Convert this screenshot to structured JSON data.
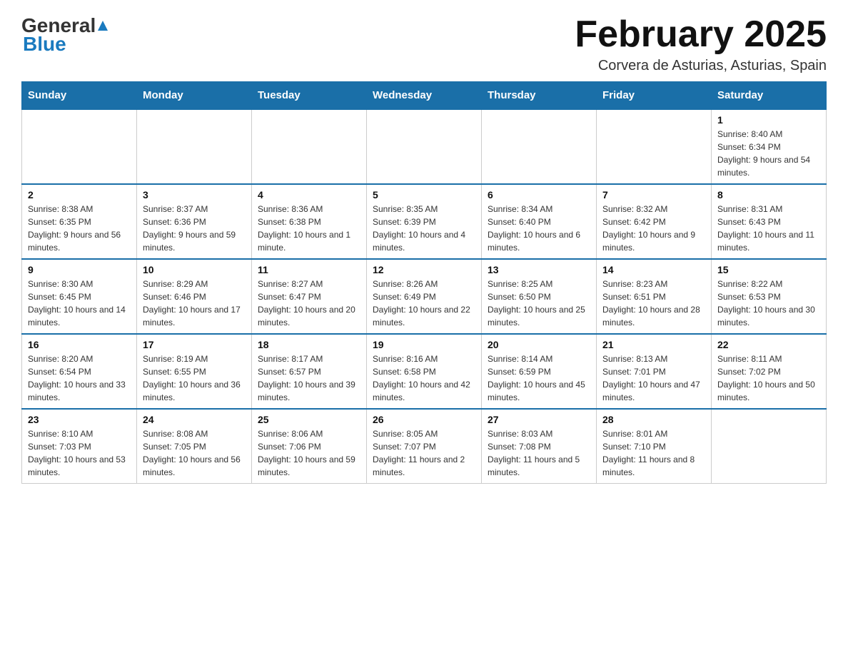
{
  "header": {
    "logo": {
      "general": "General",
      "blue": "Blue",
      "tagline": "Blue"
    },
    "title": "February 2025",
    "location": "Corvera de Asturias, Asturias, Spain"
  },
  "calendar": {
    "days_of_week": [
      "Sunday",
      "Monday",
      "Tuesday",
      "Wednesday",
      "Thursday",
      "Friday",
      "Saturday"
    ],
    "weeks": [
      [
        {
          "day": "",
          "info": ""
        },
        {
          "day": "",
          "info": ""
        },
        {
          "day": "",
          "info": ""
        },
        {
          "day": "",
          "info": ""
        },
        {
          "day": "",
          "info": ""
        },
        {
          "day": "",
          "info": ""
        },
        {
          "day": "1",
          "info": "Sunrise: 8:40 AM\nSunset: 6:34 PM\nDaylight: 9 hours and 54 minutes."
        }
      ],
      [
        {
          "day": "2",
          "info": "Sunrise: 8:38 AM\nSunset: 6:35 PM\nDaylight: 9 hours and 56 minutes."
        },
        {
          "day": "3",
          "info": "Sunrise: 8:37 AM\nSunset: 6:36 PM\nDaylight: 9 hours and 59 minutes."
        },
        {
          "day": "4",
          "info": "Sunrise: 8:36 AM\nSunset: 6:38 PM\nDaylight: 10 hours and 1 minute."
        },
        {
          "day": "5",
          "info": "Sunrise: 8:35 AM\nSunset: 6:39 PM\nDaylight: 10 hours and 4 minutes."
        },
        {
          "day": "6",
          "info": "Sunrise: 8:34 AM\nSunset: 6:40 PM\nDaylight: 10 hours and 6 minutes."
        },
        {
          "day": "7",
          "info": "Sunrise: 8:32 AM\nSunset: 6:42 PM\nDaylight: 10 hours and 9 minutes."
        },
        {
          "day": "8",
          "info": "Sunrise: 8:31 AM\nSunset: 6:43 PM\nDaylight: 10 hours and 11 minutes."
        }
      ],
      [
        {
          "day": "9",
          "info": "Sunrise: 8:30 AM\nSunset: 6:45 PM\nDaylight: 10 hours and 14 minutes."
        },
        {
          "day": "10",
          "info": "Sunrise: 8:29 AM\nSunset: 6:46 PM\nDaylight: 10 hours and 17 minutes."
        },
        {
          "day": "11",
          "info": "Sunrise: 8:27 AM\nSunset: 6:47 PM\nDaylight: 10 hours and 20 minutes."
        },
        {
          "day": "12",
          "info": "Sunrise: 8:26 AM\nSunset: 6:49 PM\nDaylight: 10 hours and 22 minutes."
        },
        {
          "day": "13",
          "info": "Sunrise: 8:25 AM\nSunset: 6:50 PM\nDaylight: 10 hours and 25 minutes."
        },
        {
          "day": "14",
          "info": "Sunrise: 8:23 AM\nSunset: 6:51 PM\nDaylight: 10 hours and 28 minutes."
        },
        {
          "day": "15",
          "info": "Sunrise: 8:22 AM\nSunset: 6:53 PM\nDaylight: 10 hours and 30 minutes."
        }
      ],
      [
        {
          "day": "16",
          "info": "Sunrise: 8:20 AM\nSunset: 6:54 PM\nDaylight: 10 hours and 33 minutes."
        },
        {
          "day": "17",
          "info": "Sunrise: 8:19 AM\nSunset: 6:55 PM\nDaylight: 10 hours and 36 minutes."
        },
        {
          "day": "18",
          "info": "Sunrise: 8:17 AM\nSunset: 6:57 PM\nDaylight: 10 hours and 39 minutes."
        },
        {
          "day": "19",
          "info": "Sunrise: 8:16 AM\nSunset: 6:58 PM\nDaylight: 10 hours and 42 minutes."
        },
        {
          "day": "20",
          "info": "Sunrise: 8:14 AM\nSunset: 6:59 PM\nDaylight: 10 hours and 45 minutes."
        },
        {
          "day": "21",
          "info": "Sunrise: 8:13 AM\nSunset: 7:01 PM\nDaylight: 10 hours and 47 minutes."
        },
        {
          "day": "22",
          "info": "Sunrise: 8:11 AM\nSunset: 7:02 PM\nDaylight: 10 hours and 50 minutes."
        }
      ],
      [
        {
          "day": "23",
          "info": "Sunrise: 8:10 AM\nSunset: 7:03 PM\nDaylight: 10 hours and 53 minutes."
        },
        {
          "day": "24",
          "info": "Sunrise: 8:08 AM\nSunset: 7:05 PM\nDaylight: 10 hours and 56 minutes."
        },
        {
          "day": "25",
          "info": "Sunrise: 8:06 AM\nSunset: 7:06 PM\nDaylight: 10 hours and 59 minutes."
        },
        {
          "day": "26",
          "info": "Sunrise: 8:05 AM\nSunset: 7:07 PM\nDaylight: 11 hours and 2 minutes."
        },
        {
          "day": "27",
          "info": "Sunrise: 8:03 AM\nSunset: 7:08 PM\nDaylight: 11 hours and 5 minutes."
        },
        {
          "day": "28",
          "info": "Sunrise: 8:01 AM\nSunset: 7:10 PM\nDaylight: 11 hours and 8 minutes."
        },
        {
          "day": "",
          "info": ""
        }
      ]
    ]
  }
}
